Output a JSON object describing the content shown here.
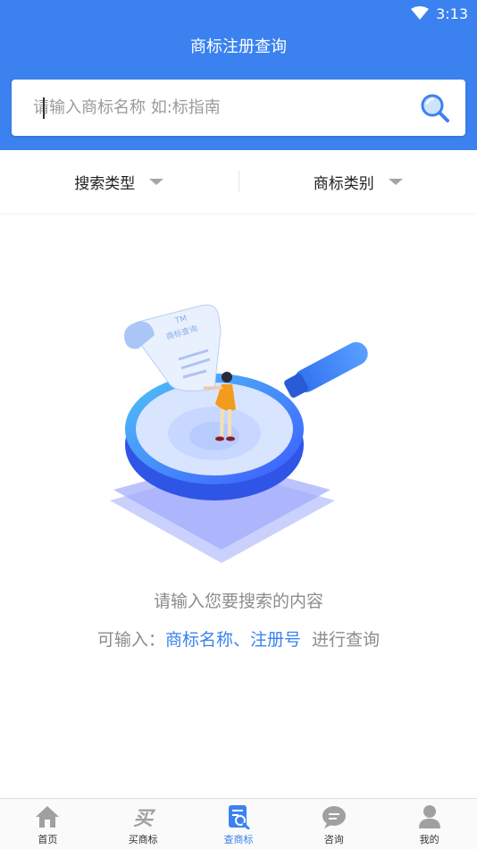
{
  "status": {
    "time": "3:13"
  },
  "header": {
    "title": "商标注册查询"
  },
  "search": {
    "placeholder": "请输入商标名称 如:标指南"
  },
  "filters": [
    {
      "label": "搜索类型"
    },
    {
      "label": "商标类别"
    }
  ],
  "illustration": {
    "badge_tm": "TM",
    "badge_text": "商标查询"
  },
  "empty": {
    "message": "请输入您要搜索的内容",
    "hint_prefix": "可输入：",
    "hint_highlight": "商标名称、注册号",
    "hint_suffix": "进行查询"
  },
  "tabs": [
    {
      "label": "首页",
      "icon": "home-icon"
    },
    {
      "label": "买商标",
      "icon": "buy-icon",
      "glyph": "买"
    },
    {
      "label": "查商标",
      "icon": "search-doc-icon",
      "active": true
    },
    {
      "label": "咨询",
      "icon": "chat-icon"
    },
    {
      "label": "我的",
      "icon": "user-icon"
    }
  ],
  "colors": {
    "primary": "#3b82f0",
    "text_gray": "#8c8c8c",
    "tab_inactive": "#a0a0a0"
  }
}
